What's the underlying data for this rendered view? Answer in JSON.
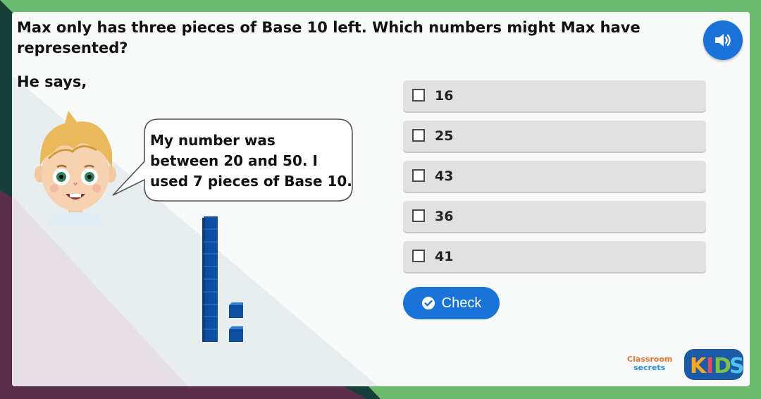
{
  "question": {
    "text": "Max only has three pieces of Base 10 left. Which numbers might Max have represented?",
    "intro": "He says,"
  },
  "speech": {
    "lines": [
      "My number was",
      "between 20 and 50. I",
      "used 7 pieces of Base 10."
    ]
  },
  "options": [
    {
      "label": "16",
      "checked": false
    },
    {
      "label": "25",
      "checked": false
    },
    {
      "label": "43",
      "checked": false
    },
    {
      "label": "36",
      "checked": false
    },
    {
      "label": "41",
      "checked": false
    }
  ],
  "actions": {
    "check_label": "Check",
    "audio_icon": "speaker-icon"
  },
  "base10": {
    "tens_rods": 1,
    "ones_cubes": 2
  },
  "logo": {
    "classroom_secrets": "Classroom secrets",
    "kids": "KIDS"
  },
  "colors": {
    "frame_green": "#6dbb6e",
    "button_blue": "#1a73d9",
    "option_gray": "#e1e1e1"
  }
}
